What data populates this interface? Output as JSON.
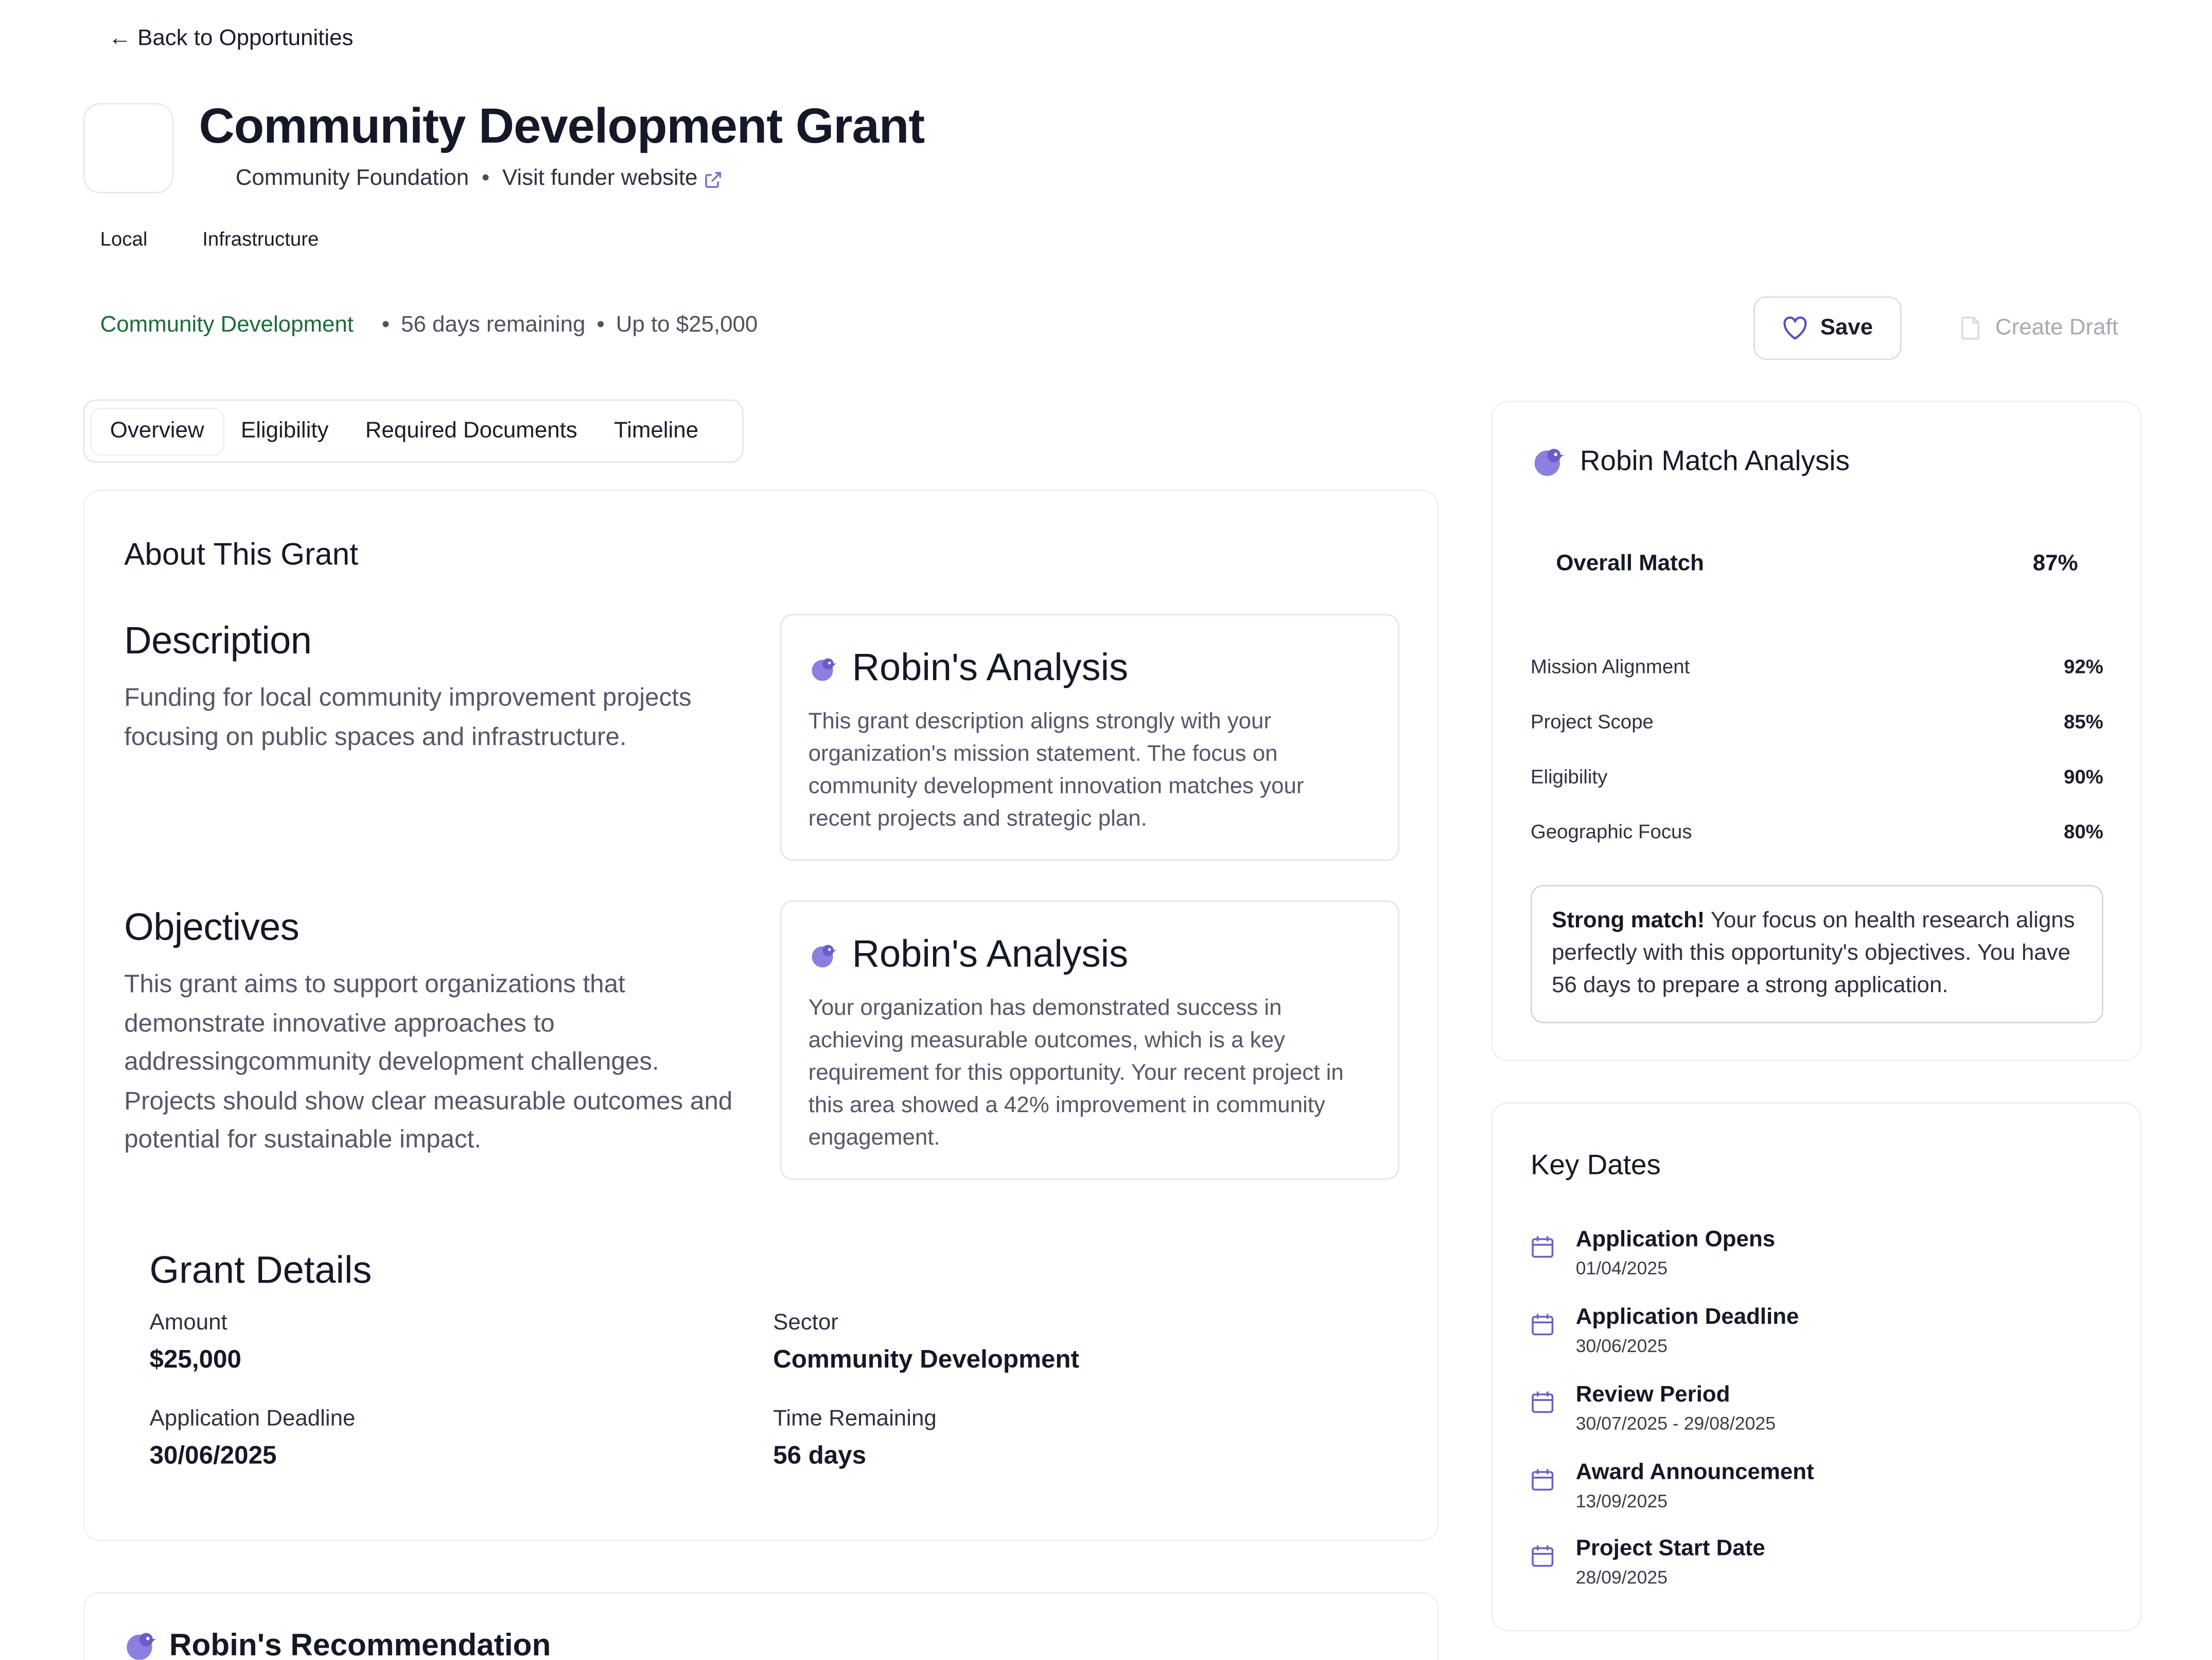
{
  "nav": {
    "back_label": "← Back to Opportunities"
  },
  "header": {
    "title": "Community Development Grant",
    "funder": "Community Foundation",
    "separator": "•",
    "visit_label": "Visit funder website",
    "tags": [
      "Local",
      "Infrastructure"
    ]
  },
  "meta": {
    "sector": "Community Development",
    "days_remaining": "56 days remaining",
    "amount": "Up to $25,000",
    "bullet": "•"
  },
  "actions": {
    "save_label": "Save",
    "draft_label": "Create Draft"
  },
  "tabs": [
    {
      "label": "Overview",
      "active": true
    },
    {
      "label": "Eligibility",
      "active": false
    },
    {
      "label": "Required Documents",
      "active": false
    },
    {
      "label": "Timeline",
      "active": false
    }
  ],
  "about": {
    "title": "About This Grant",
    "description": {
      "heading": "Description",
      "text": "Funding for local community improvement projects focusing on public spaces and infrastructure.",
      "analysis_title": "Robin's Analysis",
      "analysis_text": "This grant description aligns strongly with your organization's mission statement. The focus on community development innovation matches your recent projects and strategic plan."
    },
    "objectives": {
      "heading": "Objectives",
      "text": "This grant aims to support organizations that demonstrate innovative approaches to addressingcommunity development challenges. Projects should show clear measurable outcomes and potential for sustainable impact.",
      "analysis_title": "Robin's Analysis",
      "analysis_text": "Your organization has demonstrated success in achieving measurable outcomes, which is a key requirement for this opportunity. Your recent project in this area showed a 42% improvement in community engagement."
    }
  },
  "details": {
    "title": "Grant Details",
    "amount_label": "Amount",
    "amount_value": "$25,000",
    "sector_label": "Sector",
    "sector_value": "Community Development",
    "deadline_label": "Application Deadline",
    "deadline_value": "30/06/2025",
    "remaining_label": "Time Remaining",
    "remaining_value": "56 days"
  },
  "recommendation": {
    "title": "Robin's Recommendation"
  },
  "match": {
    "title": "Robin Match Analysis",
    "overall_label": "Overall Match",
    "overall_value": "87%",
    "rows": [
      {
        "label": "Mission Alignment",
        "value": "92%"
      },
      {
        "label": "Project Scope",
        "value": "85%"
      },
      {
        "label": "Eligibility",
        "value": "90%"
      },
      {
        "label": "Geographic Focus",
        "value": "80%"
      }
    ],
    "summary_strong": "Strong match!",
    "summary_text": " Your focus on health research aligns perfectly with this opportunity's objectives. You have 56 days to prepare a strong application."
  },
  "key_dates": {
    "title": "Key Dates",
    "items": [
      {
        "name": "Application Opens",
        "date": "01/04/2025"
      },
      {
        "name": "Application Deadline",
        "date": "30/06/2025"
      },
      {
        "name": "Review Period",
        "date": "30/07/2025 - 29/08/2025"
      },
      {
        "name": "Award Announcement",
        "date": "13/09/2025"
      },
      {
        "name": "Project Start Date",
        "date": "28/09/2025"
      }
    ]
  },
  "colors": {
    "accent_purple": "#7b6fd6",
    "sector_green": "#1e6b39",
    "disabled_gray": "#a8a9b3"
  },
  "icons": {
    "back": "arrow-left-icon",
    "external": "external-link-icon",
    "save": "heart-icon",
    "draft": "document-icon",
    "robin": "robin-bird-icon",
    "calendar": "calendar-icon"
  }
}
